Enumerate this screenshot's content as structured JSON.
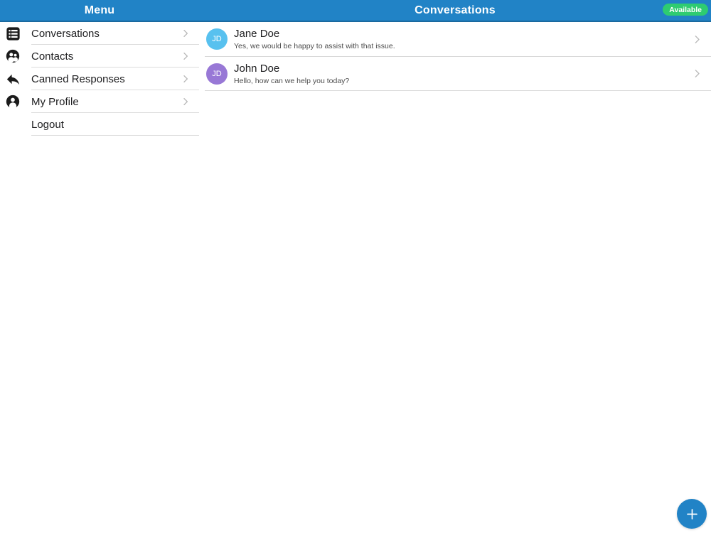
{
  "header": {
    "menu_title": "Menu",
    "conversations_title": "Conversations",
    "availability_badge": "Available",
    "colors": {
      "background": "#2183c6",
      "border": "#1a699f",
      "badge": "#2ecc71"
    }
  },
  "sidebar": {
    "items": [
      {
        "id": "conversations",
        "label": "Conversations",
        "icon": "list-icon",
        "chevron": true
      },
      {
        "id": "contacts",
        "label": "Contacts",
        "icon": "people-icon",
        "chevron": true
      },
      {
        "id": "canned-responses",
        "label": "Canned Responses",
        "icon": "reply-arrow-icon",
        "chevron": true
      },
      {
        "id": "my-profile",
        "label": "My Profile",
        "icon": "person-icon",
        "chevron": true
      },
      {
        "id": "logout",
        "label": "Logout",
        "icon": null,
        "chevron": false
      }
    ]
  },
  "conversations": {
    "rows": [
      {
        "name": "Jane Doe",
        "initials": "JD",
        "preview": "Yes, we would be happy to assist with that issue.",
        "avatar_color": "#58c1ef"
      },
      {
        "name": "John Doe",
        "initials": "JD",
        "preview": "Hello, how can we help you today?",
        "avatar_color": "#9878d6"
      }
    ]
  },
  "fab": {
    "icon": "plus-icon",
    "color": "#2183c6"
  }
}
